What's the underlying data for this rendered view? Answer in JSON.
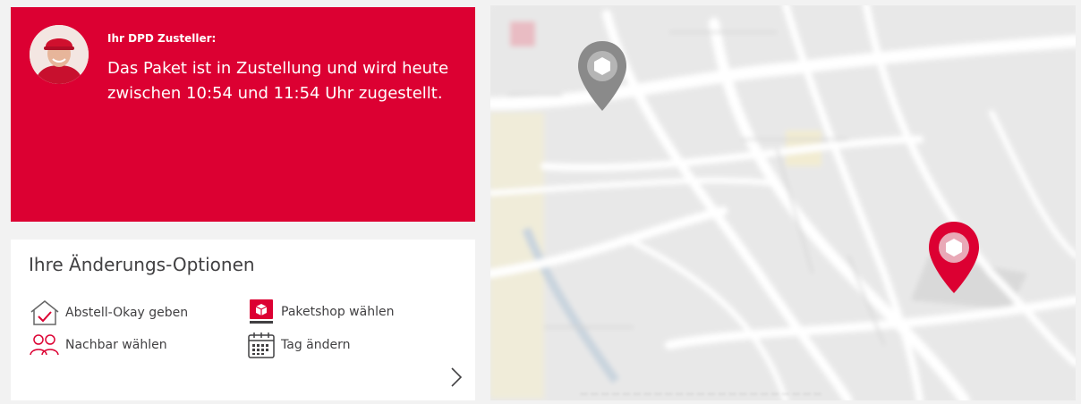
{
  "courier": {
    "label": "Ihr DPD Zusteller:",
    "message": "Das Paket ist in Zustellung und wird heute zwischen 10:54 und 11:54 Uhr zugestellt."
  },
  "options": {
    "title": "Ihre Änderungs-Optionen",
    "items": [
      {
        "label": "Abstell-Okay geben",
        "icon": "house-check-icon"
      },
      {
        "label": "Paketshop wählen",
        "icon": "parcelshop-icon"
      },
      {
        "label": "Nachbar wählen",
        "icon": "neighbors-icon"
      },
      {
        "label": "Tag ändern",
        "icon": "calendar-icon"
      }
    ],
    "next_icon": "chevron-right-icon"
  },
  "colors": {
    "brand_red": "#dc0032",
    "text_dark": "#414042",
    "map_bg": "#eaeaea",
    "pin_grey": "#8a8a8a"
  }
}
